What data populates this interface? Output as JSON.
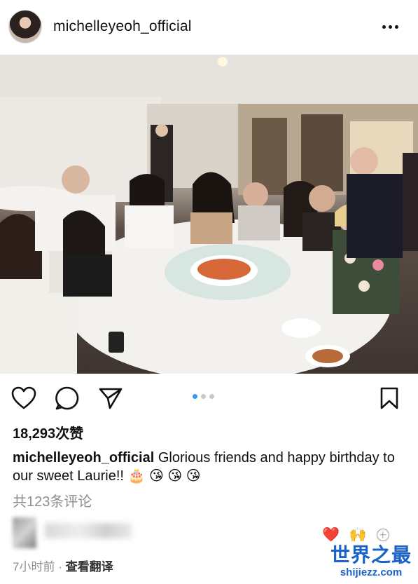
{
  "post": {
    "username": "michelleyeoh_official",
    "avatar_icon": "profile-photo",
    "more_icon": "more-horizontal-icon"
  },
  "carousel": {
    "total": 3,
    "active_index": 0,
    "active_color": "#3897f0"
  },
  "actions": {
    "like_icon": "heart-outline-icon",
    "comment_icon": "comment-bubble-icon",
    "share_icon": "paper-plane-icon",
    "save_icon": "bookmark-icon"
  },
  "likes": {
    "count_text": "18,293次赞"
  },
  "caption": {
    "author": "michelleyeoh_official",
    "text": " Glorious friends and happy birthday to our sweet Laurie!! 🎂 😘 😘 😘"
  },
  "comments": {
    "view_all": "共123条评论"
  },
  "reactions": {
    "heart": "❤️",
    "raised_hands": "🙌",
    "add_icon": "add-reaction-icon"
  },
  "footer": {
    "time": "7小时前",
    "separator": " · ",
    "translate": "查看翻译"
  },
  "watermark": {
    "title": "世界之最",
    "url": "shijiezz.com"
  }
}
